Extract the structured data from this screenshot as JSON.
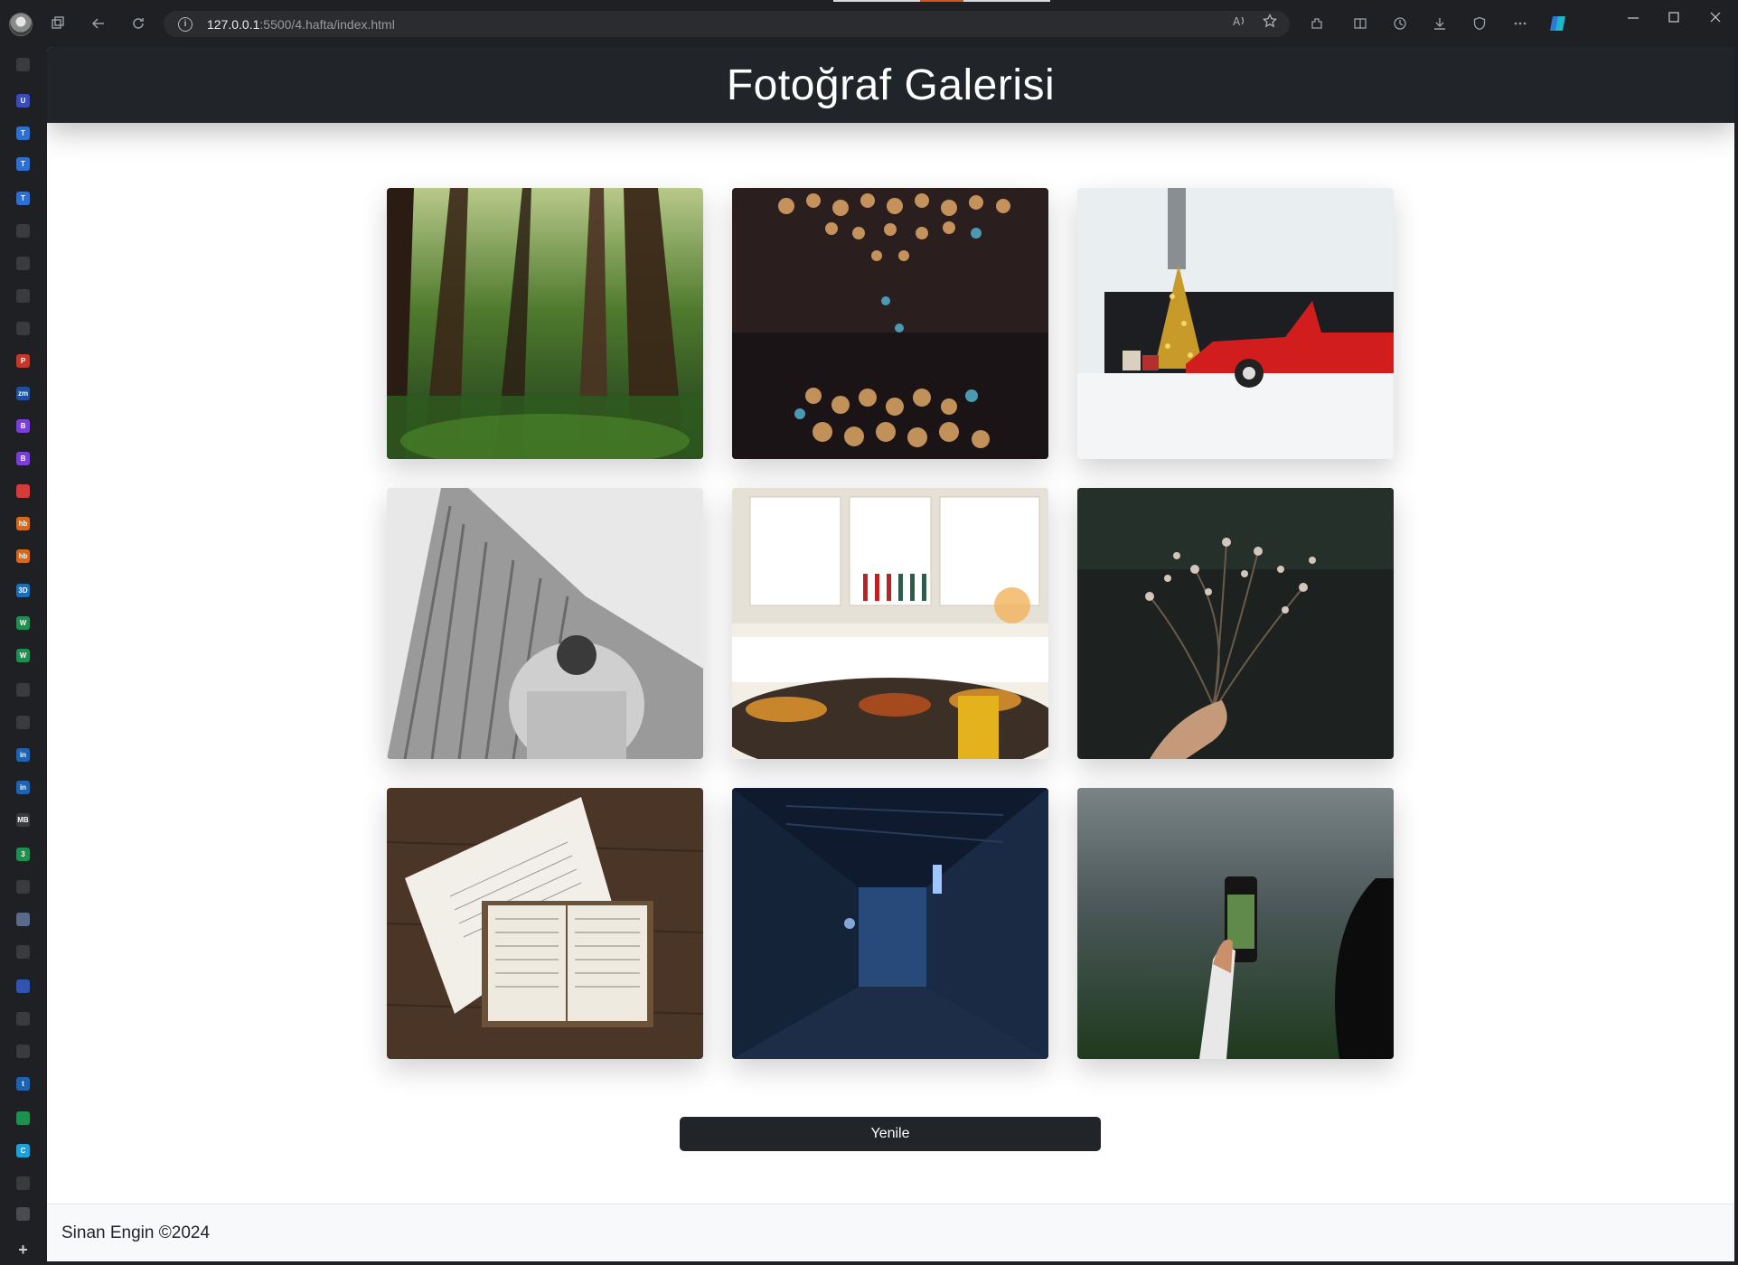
{
  "browser": {
    "url_host": "127.0.0.1",
    "url_rest": ":5500/4.hafta/index.html",
    "sidebar_icons": [
      {
        "icon": "tab-actions-icon",
        "color": "#3a3b3f",
        "text": ""
      },
      {
        "icon": "u-icon",
        "color": "#3b4bb8",
        "text": "U"
      },
      {
        "icon": "t-icon",
        "color": "#2f6fd0",
        "text": "T"
      },
      {
        "icon": "t-icon",
        "color": "#2f6fd0",
        "text": "T"
      },
      {
        "icon": "t-icon",
        "color": "#2f6fd0",
        "text": "T"
      },
      {
        "icon": "page-icon",
        "color": "#3a3b3f",
        "text": ""
      },
      {
        "icon": "signature-icon",
        "color": "#3a3b3f",
        "text": ""
      },
      {
        "icon": "signature-icon",
        "color": "#3a3b3f",
        "text": ""
      },
      {
        "icon": "calendar-icon",
        "color": "#3a3b3f",
        "text": ""
      },
      {
        "icon": "pdf-icon",
        "color": "#c0392b",
        "text": "P"
      },
      {
        "icon": "zm-icon",
        "color": "#1e4fa0",
        "text": "zm"
      },
      {
        "icon": "bootstrap-icon",
        "color": "#7a3fd6",
        "text": "B"
      },
      {
        "icon": "bootstrap-icon",
        "color": "#7a3fd6",
        "text": "B"
      },
      {
        "icon": "pocket-icon",
        "color": "#d43c3c",
        "text": ""
      },
      {
        "icon": "hb-icon",
        "color": "#d2691e",
        "text": "hb"
      },
      {
        "icon": "hb-icon",
        "color": "#d2691e",
        "text": "hb"
      },
      {
        "icon": "3d-icon",
        "color": "#1c6fb7",
        "text": "3D"
      },
      {
        "icon": "w-icon",
        "color": "#1f8f4f",
        "text": "W"
      },
      {
        "icon": "w-icon",
        "color": "#1f8f4f",
        "text": "W"
      },
      {
        "icon": "github-icon",
        "color": "#3a3b3f",
        "text": ""
      },
      {
        "icon": "save-icon",
        "color": "#3a3b3f",
        "text": ""
      },
      {
        "icon": "linkedin-icon",
        "color": "#1f62b0",
        "text": "in"
      },
      {
        "icon": "linkedin-icon",
        "color": "#1f62b0",
        "text": "in"
      },
      {
        "icon": "mb-icon",
        "color": "#3a3b3f",
        "text": "MB"
      },
      {
        "icon": "circle-icon",
        "color": "#1f8f4f",
        "text": "3"
      },
      {
        "icon": "calendar-icon",
        "color": "#3a3b3f",
        "text": ""
      },
      {
        "icon": "screen-icon",
        "color": "#5a6b8a",
        "text": ""
      },
      {
        "icon": "calendar-icon",
        "color": "#3a3b3f",
        "text": ""
      },
      {
        "icon": "globe-icon",
        "color": "#2f55b0",
        "text": ""
      },
      {
        "icon": "signature-icon",
        "color": "#3a3b3f",
        "text": ""
      },
      {
        "icon": "wordpress-icon",
        "color": "#3a3b3f",
        "text": ""
      },
      {
        "icon": "t-icon",
        "color": "#1f62b0",
        "text": "t"
      },
      {
        "icon": "leaf-icon",
        "color": "#1f8f4f",
        "text": ""
      },
      {
        "icon": "c-icon",
        "color": "#1ea0d6",
        "text": "C"
      },
      {
        "icon": "calendar-icon",
        "color": "#3a3b3f",
        "text": ""
      },
      {
        "icon": "page-icon",
        "color": "#4a4b50",
        "text": ""
      },
      {
        "icon": "add-icon",
        "color": "#1f2023",
        "text": "+"
      }
    ]
  },
  "page": {
    "title": "Fotoğraf Galerisi",
    "photos": [
      {
        "subject": "forest",
        "palette": [
          "#1d3a1a",
          "#4f7a2e",
          "#b8c98a"
        ]
      },
      {
        "subject": "bokeh-lights",
        "palette": [
          "#2a1e1f",
          "#e0a766",
          "#4fa7c4"
        ]
      },
      {
        "subject": "red-car-christmas-tree",
        "palette": [
          "#e9eef1",
          "#d11d1d",
          "#c79a2a"
        ]
      },
      {
        "subject": "skyscraper-photographer",
        "palette": [
          "#e8e8e8",
          "#8a8a8a",
          "#3a3a3a"
        ]
      },
      {
        "subject": "kitchen-table-food",
        "palette": [
          "#f3efe6",
          "#c9852c",
          "#2f5b4a"
        ]
      },
      {
        "subject": "hand-holding-dried-flowers",
        "palette": [
          "#1d2220",
          "#8a7a6a",
          "#e6d8cc"
        ]
      },
      {
        "subject": "open-book-on-wood",
        "palette": [
          "#4a3526",
          "#f1efe8",
          "#6b5238"
        ]
      },
      {
        "subject": "night-alley",
        "palette": [
          "#0f1a2e",
          "#274a7a",
          "#9ec7ff"
        ]
      },
      {
        "subject": "hand-holding-phone",
        "palette": [
          "#4a5658",
          "#2e4a2a",
          "#e8e8e8"
        ]
      }
    ],
    "refresh_button": "Yenile",
    "footer": "Sinan Engin ©2024"
  }
}
